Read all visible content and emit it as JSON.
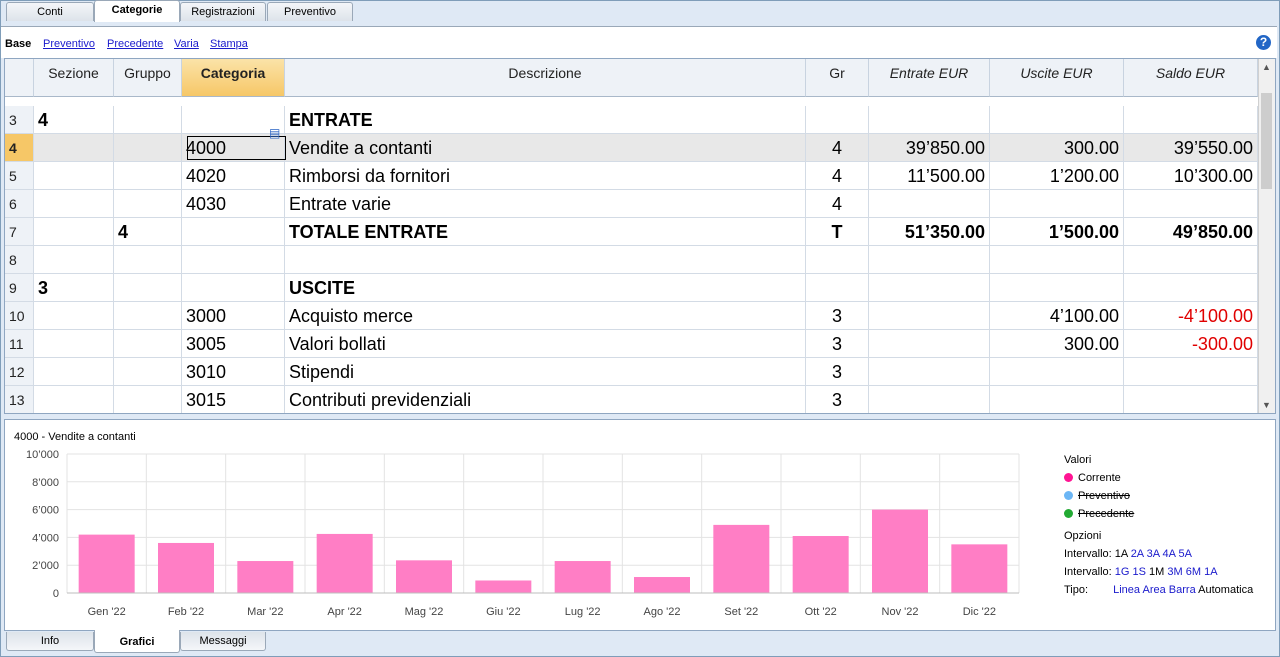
{
  "tabs_top": [
    {
      "label": "Conti"
    },
    {
      "label": "Categorie"
    },
    {
      "label": "Registrazioni"
    },
    {
      "label": "Preventivo"
    }
  ],
  "subbar": {
    "items": [
      "Base",
      "Preventivo",
      "Precedente",
      "Varia",
      "Stampa"
    ],
    "help": "?"
  },
  "grid": {
    "headers": [
      "Sezione",
      "Gruppo",
      "Categoria",
      "Descrizione",
      "Gr",
      "Entrate EUR",
      "Uscite EUR",
      "Saldo EUR"
    ],
    "rows": [
      {
        "n": "3",
        "sezione": "4",
        "gruppo": "",
        "categoria": "",
        "descrizione": "ENTRATE",
        "gr": "",
        "entrate": "",
        "uscite": "",
        "saldo": ""
      },
      {
        "n": "4",
        "sezione": "",
        "gruppo": "",
        "categoria": "4000",
        "descrizione": "Vendite a contanti",
        "gr": "4",
        "entrate": "39’850.00",
        "uscite": "300.00",
        "saldo": "39’550.00"
      },
      {
        "n": "5",
        "sezione": "",
        "gruppo": "",
        "categoria": "4020",
        "descrizione": "Rimborsi da fornitori",
        "gr": "4",
        "entrate": "11’500.00",
        "uscite": "1’200.00",
        "saldo": "10’300.00"
      },
      {
        "n": "6",
        "sezione": "",
        "gruppo": "",
        "categoria": "4030",
        "descrizione": "Entrate varie",
        "gr": "4",
        "entrate": "",
        "uscite": "",
        "saldo": ""
      },
      {
        "n": "7",
        "sezione": "",
        "gruppo": "4",
        "categoria": "",
        "descrizione": "TOTALE ENTRATE",
        "gr": "T",
        "entrate": "51’350.00",
        "uscite": "1’500.00",
        "saldo": "49’850.00"
      },
      {
        "n": "8",
        "sezione": "",
        "gruppo": "",
        "categoria": "",
        "descrizione": "",
        "gr": "",
        "entrate": "",
        "uscite": "",
        "saldo": ""
      },
      {
        "n": "9",
        "sezione": "3",
        "gruppo": "",
        "categoria": "",
        "descrizione": "USCITE",
        "gr": "",
        "entrate": "",
        "uscite": "",
        "saldo": ""
      },
      {
        "n": "10",
        "sezione": "",
        "gruppo": "",
        "categoria": "3000",
        "descrizione": "Acquisto merce",
        "gr": "3",
        "entrate": "",
        "uscite": "4’100.00",
        "saldo": "-4’100.00"
      },
      {
        "n": "11",
        "sezione": "",
        "gruppo": "",
        "categoria": "3005",
        "descrizione": "Valori bollati",
        "gr": "3",
        "entrate": "",
        "uscite": "300.00",
        "saldo": "-300.00"
      },
      {
        "n": "12",
        "sezione": "",
        "gruppo": "",
        "categoria": "3010",
        "descrizione": "Stipendi",
        "gr": "3",
        "entrate": "",
        "uscite": "",
        "saldo": ""
      },
      {
        "n": "13",
        "sezione": "",
        "gruppo": "",
        "categoria": "3015",
        "descrizione": "Contributi previdenziali",
        "gr": "3",
        "entrate": "",
        "uscite": "",
        "saldo": ""
      }
    ]
  },
  "chart_data": {
    "type": "bar",
    "title": "4000 - Vendite a contanti",
    "categories": [
      "Gen '22",
      "Feb '22",
      "Mar '22",
      "Apr '22",
      "Mag '22",
      "Giu '22",
      "Lug '22",
      "Ago '22",
      "Set '22",
      "Ott '22",
      "Nov '22",
      "Dic '22"
    ],
    "series": [
      {
        "name": "Corrente",
        "values": [
          4200,
          3600,
          2300,
          4250,
          2350,
          900,
          2300,
          1150,
          4900,
          4100,
          6000,
          3500
        ]
      }
    ],
    "yticks": [
      "10’000",
      "8’000",
      "6’000",
      "4’000",
      "2’000",
      "0"
    ],
    "ylim": [
      0,
      10000
    ],
    "grid": true,
    "bar_color": "#ff7ec5"
  },
  "legend": {
    "title": "Valori",
    "series": [
      {
        "label": "Corrente",
        "color": "#ff1493",
        "strike": false
      },
      {
        "label": "Preventivo",
        "color": "#6cb6f5",
        "strike": true
      },
      {
        "label": "Precedente",
        "color": "#22aa33",
        "strike": true
      }
    ],
    "options_title": "Opzioni",
    "intervallo1_label": "Intervallo:",
    "intervallo1": [
      "1A",
      "2A",
      "3A",
      "4A",
      "5A"
    ],
    "intervallo2_label": "Intervallo:",
    "intervallo2": [
      "1G",
      "1S",
      "1M",
      "3M",
      "6M",
      "1A"
    ],
    "tipo_label": "Tipo:",
    "tipo": [
      "Linea",
      "Area",
      "Barra",
      "Automatica"
    ]
  },
  "tabs_bottom": [
    {
      "label": "Info"
    },
    {
      "label": "Grafici"
    },
    {
      "label": "Messaggi"
    }
  ]
}
